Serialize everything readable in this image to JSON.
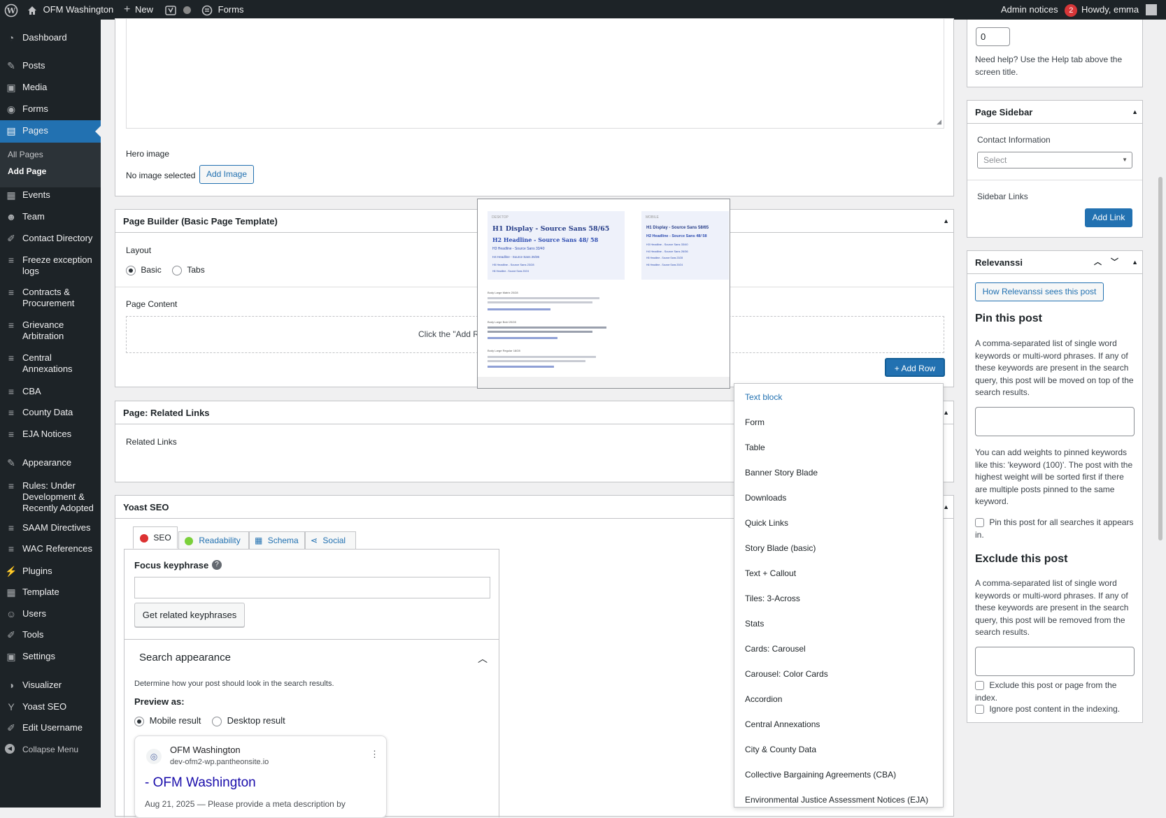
{
  "adminbar": {
    "site_name": "OFM Washington",
    "new_label": "New",
    "forms_label": "Forms",
    "notices_label": "Admin notices",
    "notices_count": "2",
    "howdy": "Howdy, emma"
  },
  "menu": {
    "items": [
      {
        "key": "dashboard",
        "label": "Dashboard",
        "icon": "gauge-icon"
      },
      {
        "key": "posts",
        "label": "Posts",
        "icon": "pin-icon"
      },
      {
        "key": "media",
        "label": "Media",
        "icon": "media-icon"
      },
      {
        "key": "forms",
        "label": "Forms",
        "icon": "forms-icon"
      },
      {
        "key": "pages",
        "label": "Pages",
        "icon": "page-icon"
      },
      {
        "key": "events",
        "label": "Events",
        "icon": "calendar-icon"
      },
      {
        "key": "team",
        "label": "Team",
        "icon": "people-icon"
      },
      {
        "key": "contact",
        "label": "Contact Directory",
        "icon": "wrench-icon"
      },
      {
        "key": "freeze",
        "label": "Freeze exception logs",
        "icon": "database-icon"
      },
      {
        "key": "contracts",
        "label": "Contracts & Procurement",
        "icon": "database-icon"
      },
      {
        "key": "grievance",
        "label": "Grievance Arbitration",
        "icon": "database-icon"
      },
      {
        "key": "central",
        "label": "Central Annexations",
        "icon": "database-icon"
      },
      {
        "key": "cba",
        "label": "CBA",
        "icon": "database-icon"
      },
      {
        "key": "county",
        "label": "County Data",
        "icon": "database-icon"
      },
      {
        "key": "eja",
        "label": "EJA Notices",
        "icon": "database-icon"
      },
      {
        "key": "appearance",
        "label": "Appearance",
        "icon": "brush-icon"
      },
      {
        "key": "rules",
        "label": "Rules: Under Development & Recently Adopted",
        "icon": "database-icon"
      },
      {
        "key": "saam",
        "label": "SAAM Directives",
        "icon": "database-icon"
      },
      {
        "key": "wac",
        "label": "WAC References",
        "icon": "database-icon"
      },
      {
        "key": "plugins",
        "label": "Plugins",
        "icon": "plug-icon"
      },
      {
        "key": "template",
        "label": "Template",
        "icon": "grid-icon"
      },
      {
        "key": "users",
        "label": "Users",
        "icon": "user-icon"
      },
      {
        "key": "tools",
        "label": "Tools",
        "icon": "wrench-icon"
      },
      {
        "key": "settings",
        "label": "Settings",
        "icon": "settings-icon"
      },
      {
        "key": "visualizer",
        "label": "Visualizer",
        "icon": "chart-icon"
      },
      {
        "key": "yoast",
        "label": "Yoast SEO",
        "icon": "yoast-icon"
      },
      {
        "key": "editusername",
        "label": "Edit Username",
        "icon": "wrench-icon"
      },
      {
        "key": "collapse",
        "label": "Collapse Menu",
        "icon": "collapse-icon"
      }
    ],
    "sub": {
      "all_pages": "All Pages",
      "add_page": "Add Page"
    }
  },
  "hero": {
    "label": "Hero image",
    "none": "No image selected",
    "add": "Add Image"
  },
  "builder": {
    "title": "Page Builder (Basic Page Template)",
    "layout": "Layout",
    "basic": "Basic",
    "tabs": "Tabs",
    "content": "Page Content",
    "hint": "Click the \"Add R",
    "add_row": "Add Row"
  },
  "preview": {
    "desktop": "DESKTOP",
    "mobile": "MOBILE",
    "h1": "H1 Display - Source Sans 58/65",
    "h2": "H2 Headline - Source Sans 48/ 58",
    "h3": "H3 Headline - Source Sans 33/40",
    "h4": "H4 Headline - Source Sans 26/36",
    "h5": "H5 Headline - Source Sans 23/28",
    "h6": "H6 Headline - Source Sans 20/24",
    "m1": "H1 Display - Source Sans 58/65",
    "m2": "H2 Headline - Source Sans 48/ 58",
    "m3": "H3 Headline - Source Sans 33/40",
    "m4": "H4 Headline - Source Sans 26/36",
    "m5": "H5 Headline - Source Sans 23/28",
    "m6": "H6 Headline - Source Sans 20/24",
    "b1": "Body Large Matrix 20/28",
    "b2": "Body Large Bold 20/28",
    "b3": "Body Large Regular 18/28"
  },
  "related": {
    "title": "Page: Related Links",
    "label": "Related Links"
  },
  "yoast": {
    "title": "Yoast SEO",
    "tabs": [
      "SEO",
      "Readability",
      "Schema",
      "Social"
    ],
    "focus": "Focus keyphrase",
    "get_related": "Get related keyphrases",
    "search_appearance": "Search appearance",
    "determine": "Determine how your post should look in the search results.",
    "preview_as": "Preview as:",
    "mobile": "Mobile result",
    "desktop": "Desktop result",
    "serp_site": "OFM Washington",
    "serp_url": "dev-ofm2-wp.pantheonsite.io",
    "serp_title": "- OFM Washington",
    "serp_desc": "Aug 21, 2025 — Please provide a meta description by"
  },
  "dropdown": {
    "items": [
      "Text block",
      "Form",
      "Table",
      "Banner Story Blade",
      "Downloads",
      "Quick Links",
      "Story Blade (basic)",
      "Text + Callout",
      "Tiles: 3-Across",
      "Stats",
      "Cards: Carousel",
      "Carousel: Color Cards",
      "Accordion",
      "Central Annexations",
      "City & County Data",
      "Collective Bargaining Agreements (CBA)",
      "Environmental Justice Assessment Notices (EJA)"
    ]
  },
  "sidebar": {
    "order_value": "0",
    "help": "Need help? Use the Help tab above the screen title.",
    "page_sidebar": {
      "title": "Page Sidebar",
      "contact": "Contact Information",
      "select": "Select",
      "links": "Sidebar Links",
      "add_link": "Add Link"
    },
    "relevanssi": {
      "title": "Relevanssi",
      "how": "How Relevanssi sees this post",
      "pin_title": "Pin this post",
      "pin_text": "A comma-separated list of single word keywords or multi-word phrases. If any of these keywords are present in the search query, this post will be moved on top of the search results.",
      "weights": "You can add weights to pinned keywords like this: 'keyword (100)'. The post with the highest weight will be sorted first if there are multiple posts pinned to the same keyword.",
      "pin_all": "Pin this post for all searches it appears in.",
      "exclude_title": "Exclude this post",
      "exclude_text": "A comma-separated list of single word keywords or multi-word phrases. If any of these keywords are present in the search query, this post will be removed from the search results.",
      "exclude_index": "Exclude this post or page from the index.",
      "ignore": "Ignore post content in the indexing."
    }
  },
  "colors": {
    "accent": "#2271b1",
    "adminbar": "#1d2327",
    "active": "#2271b1",
    "badge": "#d63638"
  }
}
